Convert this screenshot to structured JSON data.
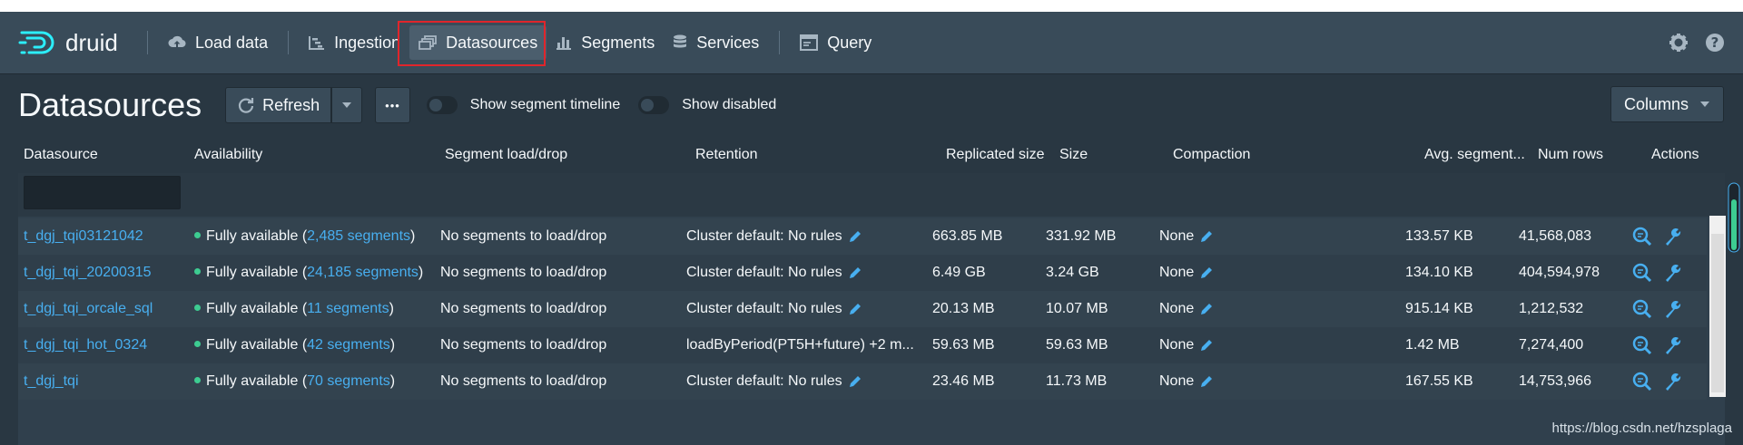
{
  "app": {
    "logo_text": "druid"
  },
  "nav": {
    "items": [
      {
        "label": "Load data",
        "icon": "cloud-upload-icon"
      },
      {
        "label": "Ingestion",
        "icon": "gantt-chart-icon"
      },
      {
        "label": "Datasources",
        "icon": "multi-select-icon",
        "active": true
      },
      {
        "label": "Segments",
        "icon": "stacked-chart-icon"
      },
      {
        "label": "Services",
        "icon": "database-icon"
      },
      {
        "label": "Query",
        "icon": "application-icon"
      }
    ],
    "right_icons": [
      "gear-icon",
      "help-icon"
    ]
  },
  "header": {
    "title": "Datasources",
    "refresh_label": "Refresh",
    "more_label": "•••",
    "toggle_timeline": "Show segment timeline",
    "toggle_disabled": "Show disabled",
    "columns_label": "Columns"
  },
  "table": {
    "columns": [
      "Datasource",
      "Availability",
      "Segment load/drop",
      "Retention",
      "Replicated size",
      "Size",
      "Compaction",
      "Avg. segment...",
      "Num rows",
      "Actions"
    ],
    "rows": [
      {
        "datasource": "t_dgj_tqi03121042",
        "avail_prefix": "Fully available (",
        "segments": "2,485 segments",
        "avail_suffix": ")",
        "load_drop": "No segments to load/drop",
        "retention": "Cluster default: No rules",
        "replicated": "663.85 MB",
        "size": "331.92 MB",
        "compaction": "None",
        "avg": "133.57 KB",
        "num_rows": "41,568,083"
      },
      {
        "datasource": "t_dgj_tqi_20200315",
        "avail_prefix": "Fully available (",
        "segments": "24,185 segments",
        "avail_suffix": ")",
        "load_drop": "No segments to load/drop",
        "retention": "Cluster default: No rules",
        "replicated": "6.49 GB",
        "size": "3.24 GB",
        "compaction": "None",
        "avg": "134.10 KB",
        "num_rows": "404,594,978"
      },
      {
        "datasource": "t_dgj_tqi_orcale_sql",
        "avail_prefix": "Fully available (",
        "segments": "11 segments",
        "avail_suffix": ")",
        "load_drop": "No segments to load/drop",
        "retention": "Cluster default: No rules",
        "replicated": "20.13 MB",
        "size": "10.07 MB",
        "compaction": "None",
        "avg": "915.14 KB",
        "num_rows": "1,212,532"
      },
      {
        "datasource": "t_dgj_tqi_hot_0324",
        "avail_prefix": "Fully available (",
        "segments": "42 segments",
        "avail_suffix": ")",
        "load_drop": "No segments to load/drop",
        "retention": "loadByPeriod(PT5H+future) +2 m...",
        "replicated": "59.63 MB",
        "size": "59.63 MB",
        "compaction": "None",
        "avg": "1.42 MB",
        "num_rows": "7,274,400"
      },
      {
        "datasource": "t_dgj_tqi",
        "avail_prefix": "Fully available (",
        "segments": "70 segments",
        "avail_suffix": ")",
        "load_drop": "No segments to load/drop",
        "retention": "Cluster default: No rules",
        "replicated": "23.46 MB",
        "size": "11.73 MB",
        "compaction": "None",
        "avg": "167.55 KB",
        "num_rows": "14,753,966"
      }
    ]
  },
  "watermark": "https://blog.csdn.net/hzsplaga",
  "colors": {
    "link": "#48aff0",
    "available": "#3dcc91",
    "highlight": "#e0252b"
  }
}
